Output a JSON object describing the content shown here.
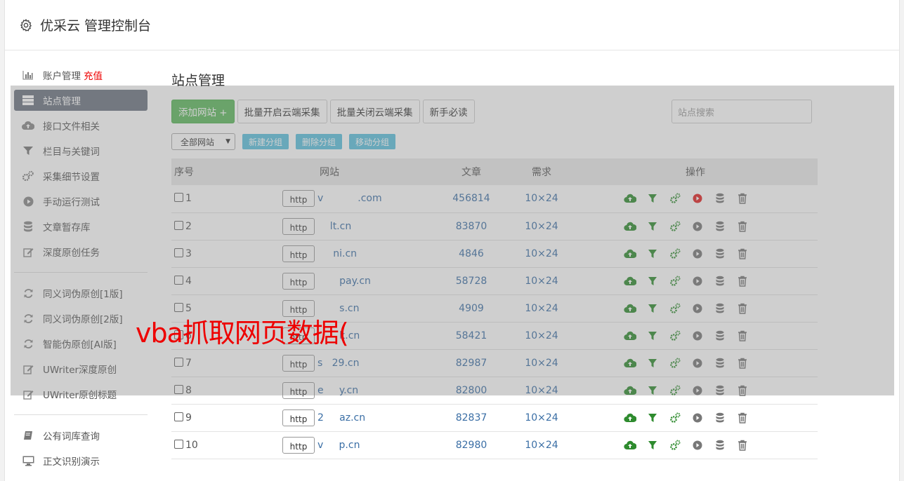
{
  "header": {
    "title": "优采云 管理控制台",
    "icon": "gear-icon"
  },
  "sidebar": {
    "group1": [
      {
        "label": "账户管理",
        "extra": "充值",
        "icon": "bar-chart-icon"
      },
      {
        "label": "站点管理",
        "icon": "server-list-icon",
        "active": true
      },
      {
        "label": "接口文件相关",
        "icon": "cloud-upload-icon"
      },
      {
        "label": "栏目与关键词",
        "icon": "filter-icon"
      },
      {
        "label": "采集细节设置",
        "icon": "gears-icon"
      },
      {
        "label": "手动运行测试",
        "icon": "play-circle-icon"
      },
      {
        "label": "文章暂存库",
        "icon": "database-icon"
      },
      {
        "label": "深度原创任务",
        "icon": "edit-icon"
      }
    ],
    "group2": [
      {
        "label": "同义词伪原创[1版]",
        "icon": "refresh-icon"
      },
      {
        "label": "同义词伪原创[2版]",
        "icon": "refresh-icon"
      },
      {
        "label": "智能伪原创[AI版]",
        "icon": "refresh-icon"
      },
      {
        "label": "UWriter深度原创",
        "icon": "edit-icon"
      },
      {
        "label": "UWriter原创标题",
        "icon": "edit-icon"
      }
    ],
    "group3": [
      {
        "label": "公有词库查询",
        "icon": "book-icon"
      },
      {
        "label": "正文识别演示",
        "icon": "monitor-icon"
      }
    ]
  },
  "main": {
    "title": "站点管理",
    "buttons": {
      "add": "添加网站 +",
      "batch_open": "批量开启云端采集",
      "batch_close": "批量关闭云端采集",
      "guide": "新手必读"
    },
    "search_placeholder": "站点搜索",
    "group_select": "全部网站",
    "group_buttons": {
      "new": "新建分组",
      "delete": "删除分组",
      "move": "移动分组"
    },
    "table": {
      "headers": {
        "no": "序号",
        "site": "网站",
        "articles": "文章",
        "demand": "需求",
        "ops": "操作"
      },
      "rows": [
        {
          "no": "1",
          "proto": "http",
          "domain": "v           .com",
          "articles": "456814",
          "demand": "10×24",
          "running": true
        },
        {
          "no": "2",
          "proto": "http",
          "domain": "    lt.cn",
          "articles": "83870",
          "demand": "10×24",
          "running": false
        },
        {
          "no": "3",
          "proto": "http",
          "domain": "     ni.cn",
          "articles": "4846",
          "demand": "10×24",
          "running": false
        },
        {
          "no": "4",
          "proto": "http",
          "domain": "       pay.cn",
          "articles": "58728",
          "demand": "10×24",
          "running": false
        },
        {
          "no": "5",
          "proto": "http",
          "domain": "       s.cn",
          "articles": "4909",
          "demand": "10×24",
          "running": false
        },
        {
          "no": "6",
          "proto": "http",
          "domain": "       k.cn",
          "articles": "58421",
          "demand": "10×24",
          "running": false
        },
        {
          "no": "7",
          "proto": "http",
          "domain": "s   29.cn",
          "articles": "82987",
          "demand": "10×24",
          "running": false
        },
        {
          "no": "8",
          "proto": "http",
          "domain": "e     y.cn",
          "articles": "82800",
          "demand": "10×24",
          "running": false
        },
        {
          "no": "9",
          "proto": "http",
          "domain": "2     az.cn",
          "articles": "82837",
          "demand": "10×24",
          "running": false
        },
        {
          "no": "10",
          "proto": "http",
          "domain": "v     p.cn",
          "articles": "82980",
          "demand": "10×24",
          "running": false
        }
      ]
    }
  },
  "watermark": "vba抓取网页数据(",
  "colors": {
    "active_nav": "#6b7380",
    "add_button": "#5cb85c",
    "group_buttons": "#5bc0de",
    "link": "#3a6ea5",
    "run_active": "#e02020",
    "icon_green": "#2e8b2e"
  }
}
